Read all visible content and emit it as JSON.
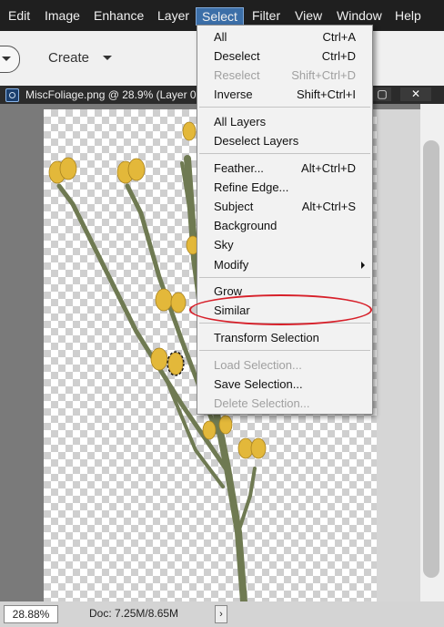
{
  "menubar": {
    "items": [
      "Edit",
      "Image",
      "Enhance",
      "Layer",
      "Select",
      "Filter",
      "View",
      "Window",
      "Help"
    ],
    "active": "Select",
    "active_color": "#3c6fa8"
  },
  "toolbar": {
    "create_label": "Create"
  },
  "document": {
    "title": "MiscFoliage.png @ 28.9% (Layer 0",
    "minimize": "—",
    "maximize": "▢",
    "close": "✕",
    "zoom": "28.88%",
    "doc_info": "Doc: 7.25M/8.65M",
    "status_arrow": "›"
  },
  "select_menu": {
    "items": [
      {
        "label": "All",
        "shortcut": "Ctrl+A",
        "disabled": false
      },
      {
        "label": "Deselect",
        "shortcut": "Ctrl+D",
        "disabled": false
      },
      {
        "label": "Reselect",
        "shortcut": "Shift+Ctrl+D",
        "disabled": true
      },
      {
        "label": "Inverse",
        "shortcut": "Shift+Ctrl+I",
        "disabled": false
      },
      {
        "label": "All Layers",
        "shortcut": "",
        "disabled": false
      },
      {
        "label": "Deselect Layers",
        "shortcut": "",
        "disabled": false
      },
      {
        "label": "Feather...",
        "shortcut": "Alt+Ctrl+D",
        "disabled": false
      },
      {
        "label": "Refine Edge...",
        "shortcut": "",
        "disabled": false
      },
      {
        "label": "Subject",
        "shortcut": "Alt+Ctrl+S",
        "disabled": false
      },
      {
        "label": "Background",
        "shortcut": "",
        "disabled": false
      },
      {
        "label": "Sky",
        "shortcut": "",
        "disabled": false
      },
      {
        "label": "Modify",
        "shortcut": "",
        "disabled": false,
        "submenu": true
      },
      {
        "label": "Grow",
        "shortcut": "",
        "disabled": false
      },
      {
        "label": "Similar",
        "shortcut": "",
        "disabled": false,
        "annotated": true
      },
      {
        "label": "Transform Selection",
        "shortcut": "",
        "disabled": false
      },
      {
        "label": "Load Selection...",
        "shortcut": "",
        "disabled": true
      },
      {
        "label": "Save Selection...",
        "shortcut": "",
        "disabled": false
      },
      {
        "label": "Delete Selection...",
        "shortcut": "",
        "disabled": true
      }
    ],
    "annotation_color": "#d7202a"
  },
  "image": {
    "stem_color": "#6f7a52",
    "bud_color": "#e3b83a"
  }
}
